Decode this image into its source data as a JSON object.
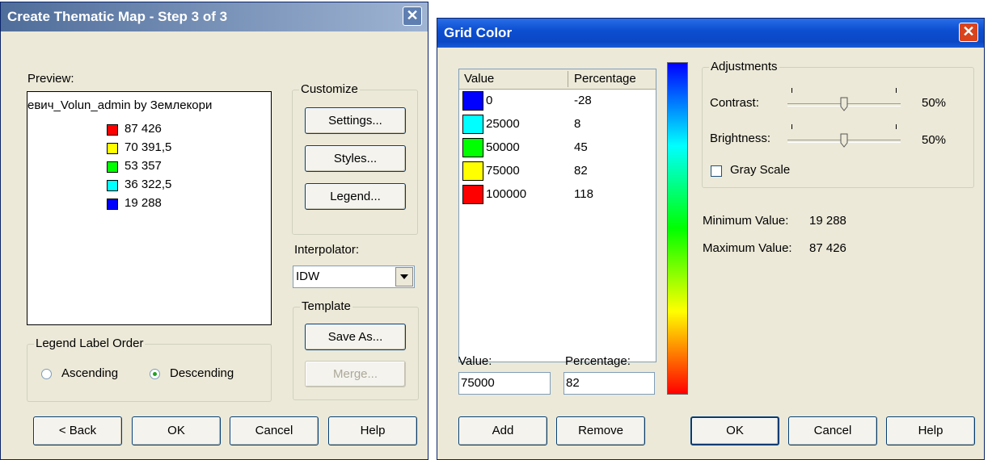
{
  "left_dialog": {
    "title": "Create Thematic Map - Step 3 of 3",
    "preview_label": "Preview:",
    "preview_title": "евич_Volun_admin by Землекори",
    "legend_items": [
      {
        "color": "#ff0000",
        "label": "87 426"
      },
      {
        "color": "#ffff00",
        "label": "70 391,5"
      },
      {
        "color": "#00ff00",
        "label": "53 357"
      },
      {
        "color": "#00ffff",
        "label": "36 322,5"
      },
      {
        "color": "#0000ff",
        "label": "19 288"
      }
    ],
    "customize": {
      "group_label": "Customize",
      "settings": "Settings...",
      "styles": "Styles...",
      "legend": "Legend..."
    },
    "interpolator_label": "Interpolator:",
    "interpolator_value": "IDW",
    "template": {
      "group_label": "Template",
      "save_as": "Save As...",
      "merge": "Merge..."
    },
    "legend_order": {
      "group_label": "Legend Label Order",
      "ascending": "Ascending",
      "descending": "Descending",
      "selected": "Descending"
    },
    "buttons": {
      "back": "< Back",
      "ok": "OK",
      "cancel": "Cancel",
      "help": "Help"
    }
  },
  "right_dialog": {
    "title": "Grid Color",
    "table": {
      "headers": [
        "Value",
        "Percentage"
      ],
      "rows": [
        {
          "color": "#0000ff",
          "value": "0",
          "percentage": "-28"
        },
        {
          "color": "#00ffff",
          "value": "25000",
          "percentage": "8"
        },
        {
          "color": "#00ff00",
          "value": "50000",
          "percentage": "45"
        },
        {
          "color": "#ffff00",
          "value": "75000",
          "percentage": "82"
        },
        {
          "color": "#ff0000",
          "value": "100000",
          "percentage": "118"
        }
      ]
    },
    "value_label": "Value:",
    "value_input": "75000",
    "percentage_label": "Percentage:",
    "percentage_input": "82",
    "adjustments": {
      "group_label": "Adjustments",
      "contrast_label": "Contrast:",
      "contrast_value": "50%",
      "contrast_level": 0.5,
      "brightness_label": "Brightness:",
      "brightness_value": "50%",
      "brightness_level": 0.5,
      "gray_scale_label": "Gray Scale",
      "gray_scale_checked": false
    },
    "minimum_label": "Minimum Value:",
    "minimum_value": "19 288",
    "maximum_label": "Maximum Value:",
    "maximum_value": "87 426",
    "buttons": {
      "add": "Add",
      "remove": "Remove",
      "ok": "OK",
      "cancel": "Cancel",
      "help": "Help"
    }
  }
}
